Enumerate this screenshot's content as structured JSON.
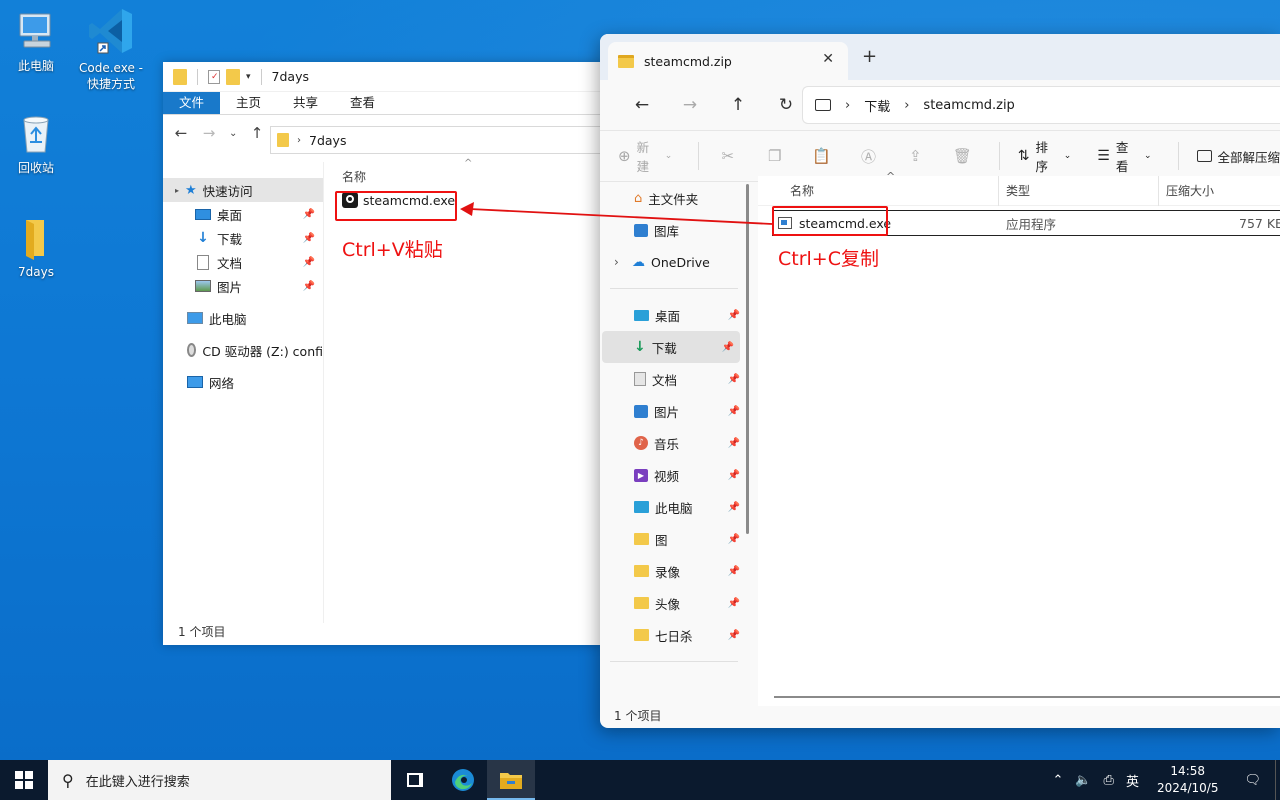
{
  "desktop": {
    "icons": [
      {
        "label": "此电脑"
      },
      {
        "label": "Code.exe - 快捷方式"
      },
      {
        "label": "回收站"
      },
      {
        "label": "7days"
      }
    ]
  },
  "classic_explorer": {
    "title": "7days",
    "ribbon_tabs": [
      "文件",
      "主页",
      "共享",
      "查看"
    ],
    "address": "7days",
    "nav": {
      "quick_access": "快速访问",
      "desktop": "桌面",
      "downloads": "下载",
      "documents": "文档",
      "pictures": "图片",
      "this_pc": "此电脑",
      "cd_drive": "CD 驱动器 (Z:) confi",
      "network": "网络"
    },
    "column_name": "名称",
    "file": "steamcmd.exe",
    "status": "1 个项目"
  },
  "win11_explorer": {
    "tab_title": "steamcmd.zip",
    "breadcrumb": [
      "下载",
      "steamcmd.zip"
    ],
    "toolbar": {
      "new": "新建",
      "sort": "排序",
      "view": "查看",
      "extract_all": "全部解压缩"
    },
    "sidebar": {
      "home": "主文件夹",
      "gallery": "图库",
      "onedrive": "OneDrive",
      "desktop": "桌面",
      "downloads": "下载",
      "documents": "文档",
      "pictures": "图片",
      "music": "音乐",
      "videos": "视频",
      "this_pc": "此电脑",
      "folder_tu": "图",
      "folder_luxiang": "录像",
      "folder_touxiang": "头像",
      "folder_7days": "七日杀"
    },
    "columns": {
      "name": "名称",
      "type": "类型",
      "compressed_size": "压缩大小"
    },
    "file": {
      "name": "steamcmd.exe",
      "type": "应用程序",
      "size": "757 KB"
    },
    "status": "1 个项目"
  },
  "annotations": {
    "paste": "Ctrl+V粘贴",
    "copy": "Ctrl+C复制",
    "color": "#e11111"
  },
  "taskbar": {
    "search_placeholder": "在此键入进行搜索",
    "ime": "英",
    "time": "14:58",
    "date": "2024/10/5"
  }
}
